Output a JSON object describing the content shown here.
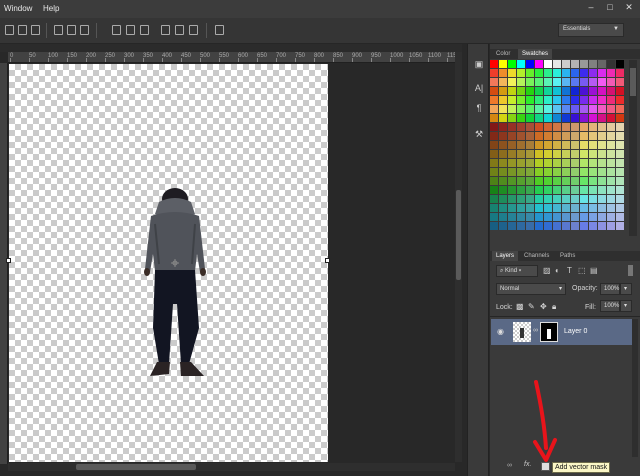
{
  "menu": {
    "window": "Window",
    "help": "Help"
  },
  "workspace": {
    "label": "Essentials"
  },
  "ruler": {
    "marks": [
      "0",
      "50",
      "100",
      "150",
      "200",
      "250",
      "300",
      "350",
      "400",
      "450",
      "500",
      "550",
      "600",
      "650",
      "700",
      "750",
      "800",
      "850",
      "900",
      "950",
      "1000",
      "1050",
      "1100",
      "1150"
    ]
  },
  "swatch_panel": {
    "tab_color": "Color",
    "tab_swatches": "Swatches"
  },
  "layers_panel": {
    "tab_layers": "Layers",
    "tab_channels": "Channels",
    "tab_paths": "Paths",
    "kind": "Kind",
    "blend_mode": "Normal",
    "opacity_label": "Opacity:",
    "opacity_value": "100%",
    "lock_label": "Lock:",
    "fill_label": "Fill:",
    "fill_value": "100%",
    "layer_name": "Layer 0"
  },
  "bottom": {
    "fx": "fx.",
    "tooltip": "Add vector mask"
  },
  "colors": {
    "accent_arrow": "#e8141b",
    "layer_selected": "#5a6986"
  }
}
